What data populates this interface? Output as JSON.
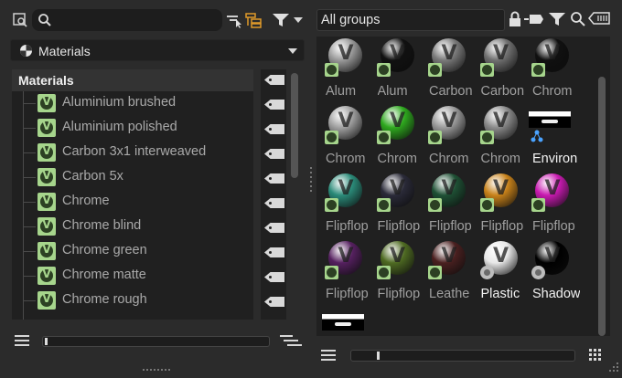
{
  "left_panel": {
    "search": {
      "placeholder": ""
    },
    "dropdown": {
      "label": "Materials",
      "icon": "material-sphere-icon"
    },
    "tree": {
      "header": "Materials",
      "items": [
        {
          "label": "Aluminium brushed"
        },
        {
          "label": "Aluminium polished"
        },
        {
          "label": "Carbon 3x1 interweaved"
        },
        {
          "label": "Carbon 5x"
        },
        {
          "label": "Chrome"
        },
        {
          "label": "Chrome blind"
        },
        {
          "label": "Chrome green"
        },
        {
          "label": "Chrome matte"
        },
        {
          "label": "Chrome rough"
        }
      ]
    },
    "toolbar_icons": [
      "search-layout-icon",
      "search-icon",
      "select-tool-icon",
      "tree-structure-icon",
      "filter-icon",
      "filter-dropdown-icon"
    ],
    "slider_value": 0
  },
  "right_panel": {
    "groups_field": {
      "value": "All groups"
    },
    "toolbar_icons": [
      "lock-icon",
      "tag-icon",
      "filter-icon",
      "search-icon",
      "tag-list-icon"
    ],
    "materials": [
      {
        "name": "Alum",
        "color": "#9a9a9a",
        "badge": "material",
        "bright": false
      },
      {
        "name": "Alum",
        "color": "#111111",
        "badge": "material",
        "bright": false
      },
      {
        "name": "Carbon",
        "color": "#7a7a7a",
        "badge": "material",
        "bright": false
      },
      {
        "name": "Carbon",
        "color": "#707070",
        "badge": "material",
        "bright": false
      },
      {
        "name": "Chrom",
        "color": "#101010",
        "badge": "material",
        "bright": false
      },
      {
        "name": "Chrom",
        "color": "#a0a0a0",
        "badge": "material",
        "bright": false
      },
      {
        "name": "Chrom",
        "color": "#2ea81e",
        "badge": "material",
        "bright": false
      },
      {
        "name": "Chrom",
        "color": "#9a9a9a",
        "badge": "material",
        "bright": false
      },
      {
        "name": "Chrom",
        "color": "#8a8a8a",
        "badge": "material",
        "bright": false
      },
      {
        "name": "Environ",
        "color": "",
        "badge": "environment",
        "bright": true
      },
      {
        "name": "Flipflop",
        "color": "#2a8a78",
        "badge": "material",
        "bright": false
      },
      {
        "name": "Flipflop",
        "color": "#2a2a38",
        "badge": "material",
        "bright": false
      },
      {
        "name": "Flipflop",
        "color": "#1e5034",
        "badge": "material",
        "bright": false
      },
      {
        "name": "Flipflop",
        "color": "#c8821a",
        "badge": "material",
        "bright": false
      },
      {
        "name": "Flipflop",
        "color": "#c81ab0",
        "badge": "material",
        "bright": false
      },
      {
        "name": "Flipflop",
        "color": "#55205f",
        "badge": "material",
        "bright": false
      },
      {
        "name": "Flipflop",
        "color": "#4e6a22",
        "badge": "material",
        "bright": false
      },
      {
        "name": "Leathe",
        "color": "#4a2020",
        "badge": "material",
        "bright": false
      },
      {
        "name": "Plastic",
        "color": "#e8e8e8",
        "badge": "gray",
        "bright": true
      },
      {
        "name": "Shadow",
        "color": "#000000",
        "badge": "gray",
        "bright": true
      }
    ],
    "slider_value": 0.12
  }
}
